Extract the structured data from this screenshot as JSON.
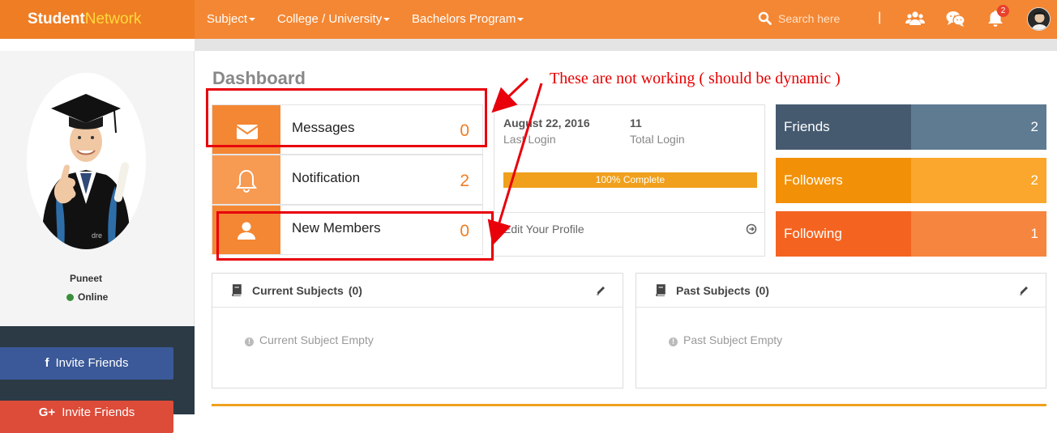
{
  "brand": {
    "part1": "Student",
    "part2": "Network"
  },
  "nav": {
    "items": [
      "Subject",
      "College / University",
      "Bachelors Program"
    ],
    "search_placeholder": "Search here",
    "separator": "|",
    "notification_count": "2"
  },
  "sidebar": {
    "name": "Puneet",
    "status": "Online",
    "facebook_invite": "Invite Friends",
    "google_invite": "Invite Friends",
    "google_prefix": "G+"
  },
  "dashboard": {
    "title": "Dashboard",
    "stats": [
      {
        "label": "Messages",
        "value": "0",
        "icon": "envelope-icon"
      },
      {
        "label": "Notification",
        "value": "2",
        "icon": "bell-icon"
      },
      {
        "label": "New Members",
        "value": "0",
        "icon": "user-icon"
      }
    ],
    "login": {
      "date": "August 22, 2016",
      "date_label": "Last Login",
      "count": "11",
      "count_label": "Total Login",
      "progress_text": "100% Complete",
      "progress_percent": 100,
      "edit_profile": "Edit Your Profile"
    },
    "social": [
      {
        "label": "Friends",
        "value": "2",
        "color_left": "#455a6f",
        "color_right": "#5f7b92"
      },
      {
        "label": "Followers",
        "value": "2",
        "color_left": "#f29107",
        "color_right": "#fba62c"
      },
      {
        "label": "Following",
        "value": "1",
        "color_left": "#f46420",
        "color_right": "#f6853f"
      }
    ],
    "current_subjects": {
      "title": "Current Subjects",
      "count": "(0)",
      "empty": "Current Subject Empty"
    },
    "past_subjects": {
      "title": "Past Subjects",
      "count": "(0)",
      "empty": "Past Subject Empty"
    }
  },
  "annotation": {
    "text": "These are not working ( should be dynamic )"
  },
  "colors": {
    "orange": "#f48733",
    "accent": "#ef7d24",
    "red_annotation": "#e8000b"
  }
}
